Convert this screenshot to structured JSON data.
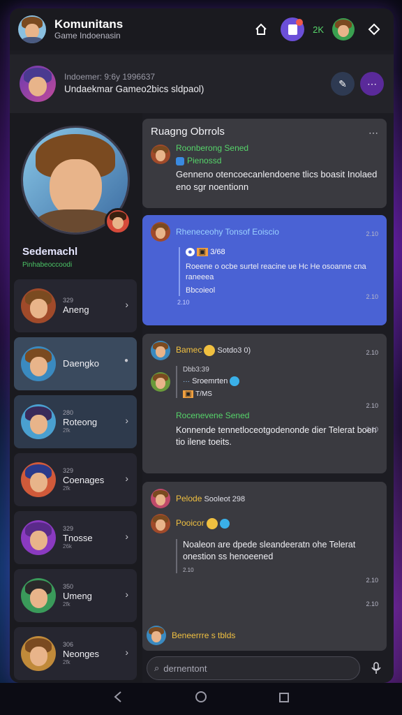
{
  "header": {
    "title": "Komunitans",
    "subtitle": "Game Indoenasin",
    "count_label": "2K"
  },
  "banner": {
    "line1": "Indoemer: 9:6y 1996637",
    "line2": "Undaekmar Gameo2bics sldpaol)"
  },
  "profile": {
    "name": "Sedemachl",
    "subtitle": "Pinhabeoccoodi"
  },
  "friends": [
    {
      "num": "329",
      "name": "Aneng",
      "sub": "",
      "active": false
    },
    {
      "num": "",
      "name": "Daengko",
      "sub": "",
      "active": true
    },
    {
      "num": "280",
      "name": "Roteong",
      "sub": "2fk",
      "active": false
    },
    {
      "num": "329",
      "name": "Coenages",
      "sub": "2fk",
      "active": false
    },
    {
      "num": "329",
      "name": "Tnosse",
      "sub": "26k",
      "active": false
    },
    {
      "num": "350",
      "name": "Umeng",
      "sub": "2fk",
      "active": false
    },
    {
      "num": "306",
      "name": "Neonges",
      "sub": "2fk",
      "active": false
    }
  ],
  "chat": {
    "card1": {
      "title": "Ruagng Obrrols",
      "sender": "Roonberong Sened",
      "reply_name": "Pienossd",
      "text": "Genneno otencoecanlendoene tlics boasit Inolaed eno sgr noentionn"
    },
    "card2": {
      "sender": "Rheneceohy Tonsof Eoiscio",
      "time1": "2.10",
      "tag": "3/68",
      "text": "Roeene o ocbe surtel reacine ue Hc He osoanne cna raneeea",
      "text2": "Bbcoieol",
      "time2": "2.10",
      "time3": "2.10"
    },
    "card3": {
      "sender": "Bamec",
      "sender_suffix": "Sotdo3 0)",
      "time1": "2.10",
      "sub_num": "Dbb3:39",
      "reply_name": "Sroemrten",
      "tag": "T/MS",
      "time2": "2.10",
      "sender2": "Rocenevene Sened",
      "time3": "2.10",
      "text": "Konnende tennetloceotgodenonde dier Telerat boen tio ilene toeits."
    },
    "card4": {
      "sender": "Pelode",
      "sender_suffix": "Sooleot 298",
      "reply_name": "Pooicor",
      "text": "Noaleon are dpede sleandeeratn ohe Telerat onestion ss henoeened",
      "time_small": "2.10",
      "time1": "2.10",
      "time2": "2.10"
    },
    "last_sender": "Beneerrre s tblds",
    "input_placeholder": "dernentont"
  },
  "colors": {
    "accent_blue": "#4a62d4",
    "accent_purple": "#6b4fd8",
    "online_green": "#56d46a"
  }
}
